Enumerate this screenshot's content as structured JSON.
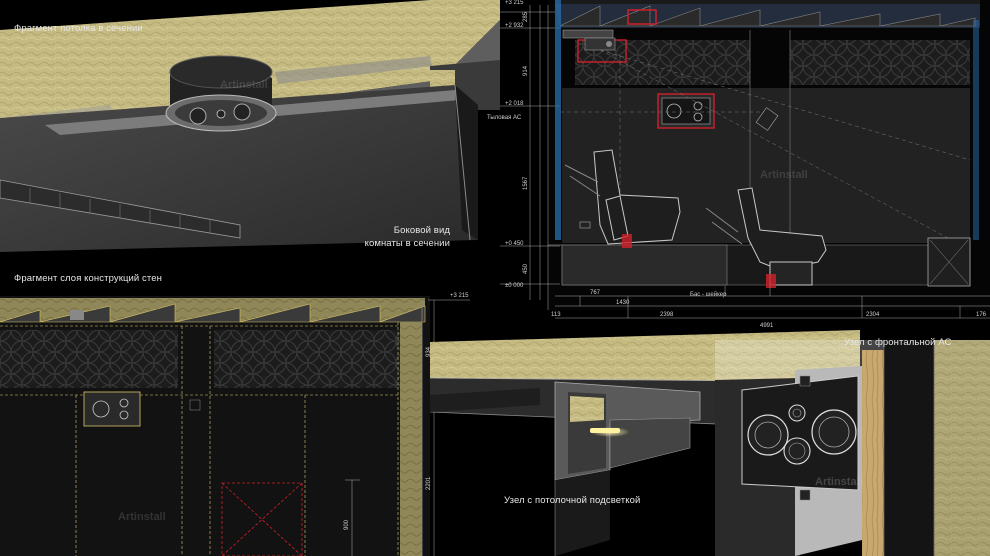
{
  "labels": {
    "ceiling_fragment": "Фрагмент потолка в сечении",
    "side_view_line1": "Боковой вид",
    "side_view_line2": "комнаты в сечении",
    "wall_layers": "Фрагмент слоя конструкций стен",
    "front_speaker_node": "Узел с фронтальной АС",
    "ceiling_light_node": "Узел с потолочной подсветкой"
  },
  "section": {
    "rear_speaker": "Тыловая АС",
    "bass_shaker": "Бас - шейкер",
    "levels": [
      "+3 215",
      "+2 932",
      "+2 018",
      "+0 450",
      "±0 000"
    ],
    "vertical_dims": [
      "285",
      "914",
      "1567",
      "450"
    ],
    "horizontal_dims": [
      "767",
      "1430",
      "113",
      "2398",
      "2304",
      "176",
      "4991"
    ]
  },
  "wall": {
    "level": "+3 215",
    "dims": [
      "934",
      "2201",
      "900"
    ]
  },
  "watermark": "Artinstall",
  "colors": {
    "background": "#000000",
    "insulation": "#c9c089",
    "panel": "#2a2a2a",
    "highlight_red": "#d0202a",
    "accent_blue": "#2a6fb0",
    "led_warm": "#f3e9a0"
  },
  "icons": [
    "ceiling-speaker-icon",
    "front-speaker-icon",
    "projector-icon",
    "recliner-seat-icon",
    "subwoofer-icon"
  ]
}
